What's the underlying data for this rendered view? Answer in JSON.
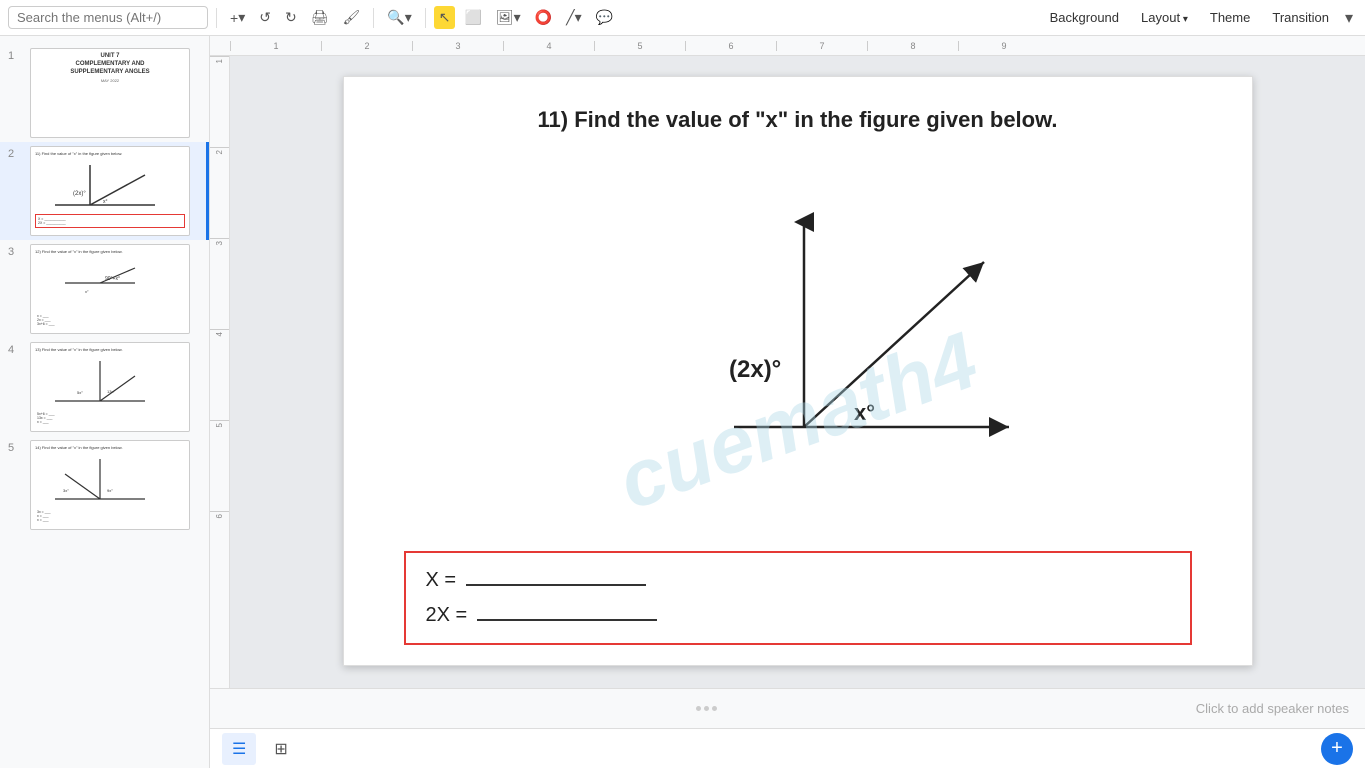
{
  "toolbar": {
    "search_placeholder": "Search the menus (Alt+/)",
    "add_label": "+",
    "undo_label": "↺",
    "redo_label": "↻",
    "print_label": "🖨",
    "paint_label": "🖌",
    "zoom_label": "🔍",
    "bg_label": "Background",
    "layout_label": "Layout",
    "theme_label": "Theme",
    "transition_label": "Transition"
  },
  "slides": [
    {
      "number": "1",
      "title": "UNIT 7\nCOMPLEMENTARY AND\nSUPPLEMENTARY ANGLES",
      "subtitle": "MAY 2022"
    },
    {
      "number": "2"
    },
    {
      "number": "3"
    },
    {
      "number": "4"
    },
    {
      "number": "5"
    }
  ],
  "current_slide": {
    "question_number": "11)",
    "question_text": "Find the value of  \"x\" in the figure given below.",
    "angle1_label": "(2x)°",
    "angle2_label": "x°",
    "answer_line1": "X = ",
    "answer_line2": "2X = ",
    "watermark": "cuemath4"
  },
  "notes": {
    "placeholder": "Click to add speaker notes",
    "dots": [
      "•",
      "•",
      "•"
    ]
  },
  "bottom_tabs": {
    "grid_icon": "⊞",
    "list_icon": "☰"
  }
}
